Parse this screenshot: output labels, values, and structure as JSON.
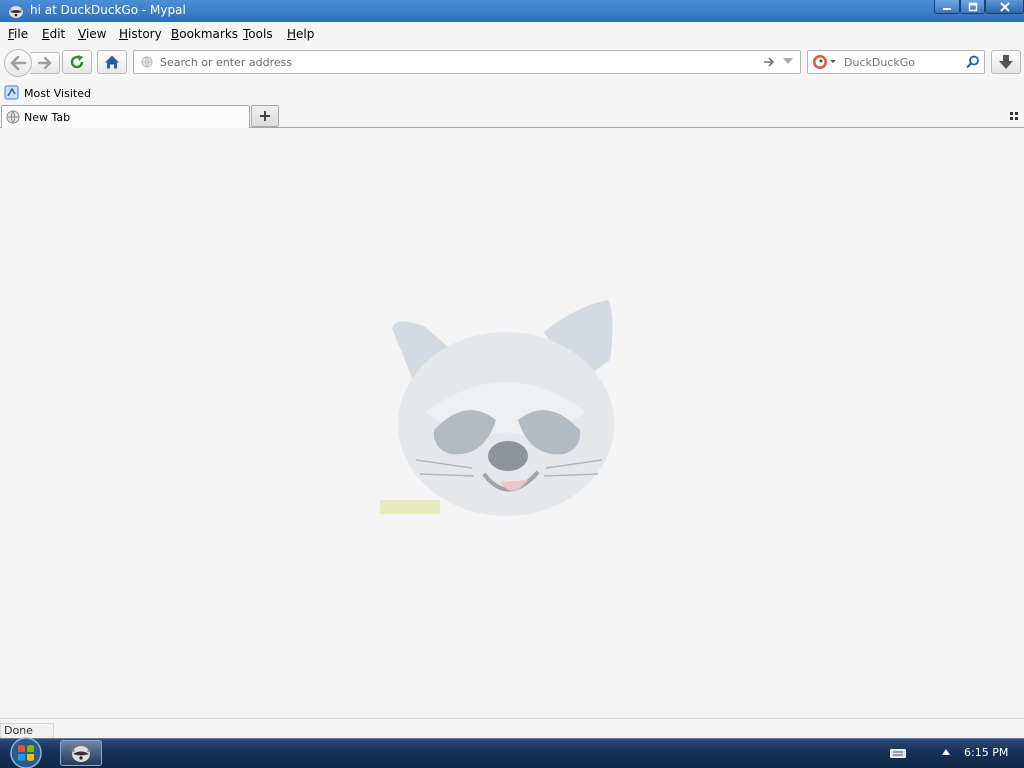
{
  "window": {
    "title": "hi at DuckDuckGo - Mypal"
  },
  "menu": {
    "items": [
      "File",
      "Edit",
      "View",
      "History",
      "Bookmarks",
      "Tools",
      "Help"
    ]
  },
  "nav": {
    "url_placeholder": "Search or enter address",
    "search_engine": "DuckDuckGo",
    "search_placeholder": "DuckDuckGo"
  },
  "bookmarks": {
    "items": [
      {
        "label": "Most Visited",
        "icon": "bookmark-folder-icon"
      }
    ]
  },
  "tabs": [
    {
      "label": "New Tab",
      "icon": "globe-icon",
      "active": true
    }
  ],
  "content": {
    "image": "raccoon-mascot-logo"
  },
  "status": {
    "text": "Done"
  },
  "taskbar": {
    "clock": "6:15 PM"
  },
  "colors": {
    "titlebar": "#2d6fb8",
    "taskbar": "#17335a",
    "content_bg": "#f4f4f4"
  }
}
